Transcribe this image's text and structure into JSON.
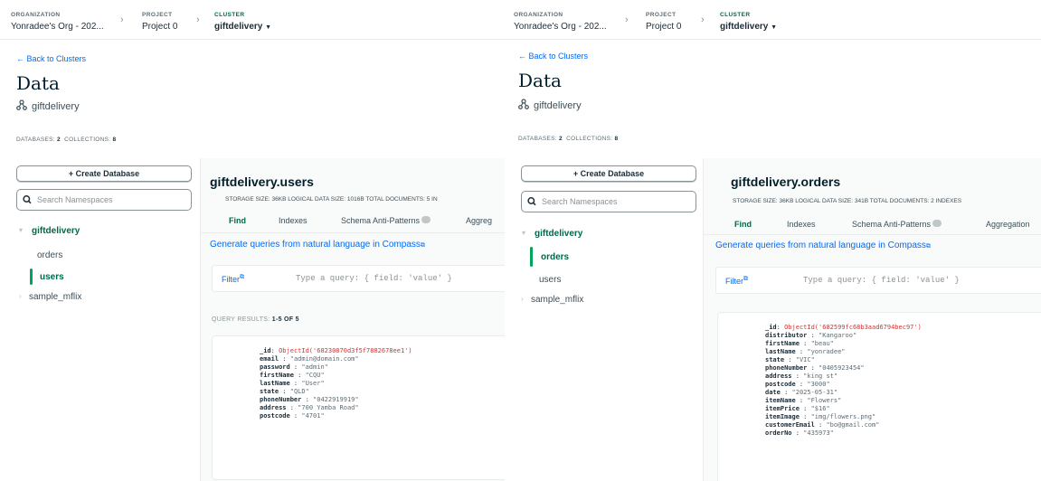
{
  "left": {
    "breadcrumb": {
      "org_label": "ORGANIZATION",
      "org_value": "Yonradee's Org - 202...",
      "project_label": "PROJECT",
      "project_value": "Project 0",
      "cluster_label": "CLUSTER",
      "cluster_value": "giftdelivery"
    },
    "back_link": "← Back to Clusters",
    "page_title": "Data",
    "cluster_name": "giftdelivery",
    "stats_databases_label": "DATABASES:",
    "stats_databases": "2",
    "stats_collections_label": "COLLECTIONS:",
    "stats_collections": "8",
    "create_db": "+ Create Database",
    "search_placeholder": "Search Namespaces",
    "tree": {
      "db1": "giftdelivery",
      "coll1": "orders",
      "coll2": "users",
      "db2": "sample_mflix"
    },
    "namespace": "giftdelivery.users",
    "ns_stats": "STORAGE SIZE: 36KB   LOGICAL DATA SIZE: 1016B   TOTAL DOCUMENTS: 5   IN",
    "tabs": [
      "Find",
      "Indexes",
      "Schema Anti-Patterns",
      "Aggreg"
    ],
    "generate_link": "Generate queries from natural language in Compass",
    "filter_label": "Filter",
    "filter_placeholder": "Type a query: { field: 'value' }",
    "results_label": "QUERY RESULTS:",
    "results_value": "1-5 OF 5",
    "doc": [
      {
        "k": "_id",
        "v": "ObjectId('68230870d3f5f7882678ee1')",
        "t": "o"
      },
      {
        "k": "email",
        "v": "\"admin@domain.com\"",
        "t": "s"
      },
      {
        "k": "password",
        "v": "\"admin\"",
        "t": "s"
      },
      {
        "k": "firstName",
        "v": "\"CQU\"",
        "t": "s"
      },
      {
        "k": "lastName",
        "v": "\"User\"",
        "t": "s"
      },
      {
        "k": "state",
        "v": "\"QLD\"",
        "t": "s"
      },
      {
        "k": "phoneNumber",
        "v": "\"0422919919\"",
        "t": "s"
      },
      {
        "k": "address",
        "v": "\"700 Yamba Road\"",
        "t": "s"
      },
      {
        "k": "postcode",
        "v": "\"4701\"",
        "t": "s"
      }
    ]
  },
  "right": {
    "breadcrumb": {
      "org_label": "ORGANIZATION",
      "org_value": "Yonradee's Org - 202...",
      "project_label": "PROJECT",
      "project_value": "Project 0",
      "cluster_label": "CLUSTER",
      "cluster_value": "giftdelivery"
    },
    "back_link": "← Back to Clusters",
    "page_title": "Data",
    "cluster_name": "giftdelivery",
    "stats_databases_label": "DATABASES:",
    "stats_databases": "2",
    "stats_collections_label": "COLLECTIONS:",
    "stats_collections": "8",
    "create_db": "+ Create Database",
    "search_placeholder": "Search Namespaces",
    "tree": {
      "db1": "giftdelivery",
      "coll1": "orders",
      "coll2": "users",
      "db2": "sample_mflix"
    },
    "namespace": "giftdelivery.orders",
    "ns_stats": "STORAGE SIZE: 36KB   LOGICAL DATA SIZE: 341B   TOTAL DOCUMENTS: 2   INDEXES",
    "tabs": [
      "Find",
      "Indexes",
      "Schema Anti-Patterns",
      "Aggregation"
    ],
    "generate_link": "Generate queries from natural language in Compass",
    "filter_label": "Filter",
    "filter_placeholder": "Type a query: { field: 'value' }",
    "doc": [
      {
        "k": "_id",
        "v": "ObjectId('682599fc68b3aad6794bec97')",
        "t": "o"
      },
      {
        "k": "distributor",
        "v": "\"Kangaroo\"",
        "t": "s"
      },
      {
        "k": "firstName",
        "v": "\"beau\"",
        "t": "s"
      },
      {
        "k": "lastName",
        "v": "\"yonradee\"",
        "t": "s"
      },
      {
        "k": "state",
        "v": "\"VIC\"",
        "t": "s"
      },
      {
        "k": "phoneNumber",
        "v": "\"0405923454\"",
        "t": "s"
      },
      {
        "k": "address",
        "v": "\"king st\"",
        "t": "s"
      },
      {
        "k": "postcode",
        "v": "\"3000\"",
        "t": "s"
      },
      {
        "k": "date",
        "v": "\"2025-05-31\"",
        "t": "s"
      },
      {
        "k": "itemName",
        "v": "\"Flowers\"",
        "t": "s"
      },
      {
        "k": "itemPrice",
        "v": "\"$16\"",
        "t": "s"
      },
      {
        "k": "itemImage",
        "v": "\"img/flowers.png\"",
        "t": "s"
      },
      {
        "k": "customerEmail",
        "v": "\"bo@gmail.com\"",
        "t": "s"
      },
      {
        "k": "orderNo",
        "v": "\"435973\"",
        "t": "s"
      }
    ]
  },
  "icons": {
    "back": "arrow-left-icon",
    "cluster": "cluster-nodes-icon",
    "search": "search-icon",
    "external": "external-link-icon",
    "caret": "caret-down-icon"
  },
  "colors": {
    "accent_green": "#00684a",
    "active_bar": "#00a35c",
    "link_blue": "#016bf8",
    "objectid_red": "#db3030"
  }
}
